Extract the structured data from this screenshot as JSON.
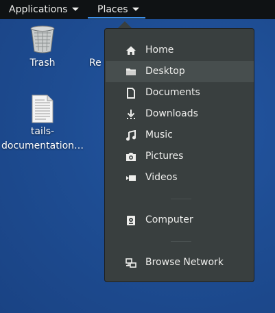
{
  "topbar": {
    "applications_label": "Applications",
    "places_label": "Places"
  },
  "desktop": {
    "trash_label": "Trash",
    "partial_label": "Re",
    "doc_label_line1": "tails-",
    "doc_label_line2": "documentation…"
  },
  "places_menu": {
    "items": [
      {
        "label": "Home",
        "icon": "home-icon"
      },
      {
        "label": "Desktop",
        "icon": "folder-icon"
      },
      {
        "label": "Documents",
        "icon": "document-icon"
      },
      {
        "label": "Downloads",
        "icon": "download-icon"
      },
      {
        "label": "Music",
        "icon": "music-icon"
      },
      {
        "label": "Pictures",
        "icon": "camera-icon"
      },
      {
        "label": "Videos",
        "icon": "video-icon"
      },
      {
        "label": "Computer",
        "icon": "computer-icon"
      },
      {
        "label": "Browse Network",
        "icon": "network-icon"
      }
    ],
    "highlighted_item": "Desktop"
  },
  "colors": {
    "menu_bg": "#393f3f",
    "highlight": "#474e4e",
    "topbar_bg": "#0f1214",
    "accent": "#3d8ee6"
  }
}
